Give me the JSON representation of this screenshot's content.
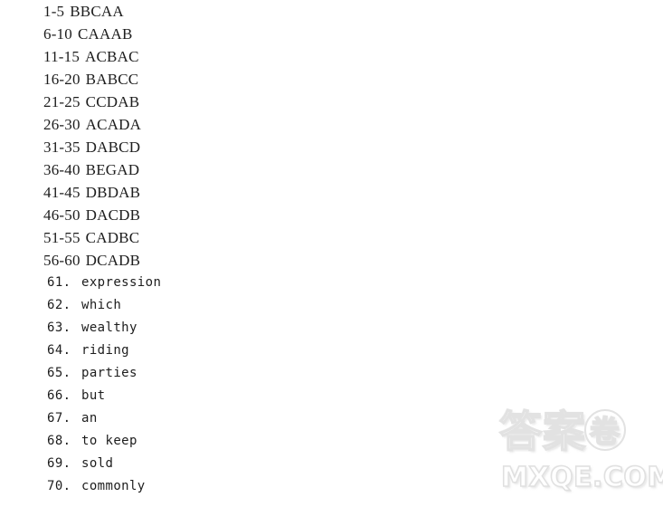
{
  "document": {
    "type": "answer-key",
    "background_color": "#ffffff",
    "text_color": "#1d1d1d"
  },
  "choice_answers": [
    {
      "range": "1-5",
      "letters": "BBCAA"
    },
    {
      "range": "6-10",
      "letters": "CAAAB"
    },
    {
      "range": "11-15",
      "letters": "ACBAC"
    },
    {
      "range": "16-20",
      "letters": "BABCC"
    },
    {
      "range": "21-25",
      "letters": "CCDAB"
    },
    {
      "range": "26-30",
      "letters": "ACADA"
    },
    {
      "range": "31-35",
      "letters": "DABCD"
    },
    {
      "range": "36-40",
      "letters": "BEGAD"
    },
    {
      "range": "41-45",
      "letters": "DBDAB"
    },
    {
      "range": "46-50",
      "letters": "DACDB"
    },
    {
      "range": "51-55",
      "letters": "CADBC"
    },
    {
      "range": "56-60",
      "letters": "DCADB"
    }
  ],
  "word_answers": [
    {
      "number": "61.",
      "word": "expression"
    },
    {
      "number": "62.",
      "word": "which"
    },
    {
      "number": "63.",
      "word": "wealthy"
    },
    {
      "number": "64.",
      "word": "riding"
    },
    {
      "number": "65.",
      "word": "parties"
    },
    {
      "number": "66.",
      "word": "but"
    },
    {
      "number": "67.",
      "word": "an"
    },
    {
      "number": "68.",
      "word": "to keep"
    },
    {
      "number": "69.",
      "word": "sold"
    },
    {
      "number": "70.",
      "word": "commonly"
    }
  ],
  "watermark": {
    "cjk_first": "答案",
    "cjk_circled": "卷",
    "domain": "MXQE.COM",
    "color": "#e5e5e5"
  }
}
